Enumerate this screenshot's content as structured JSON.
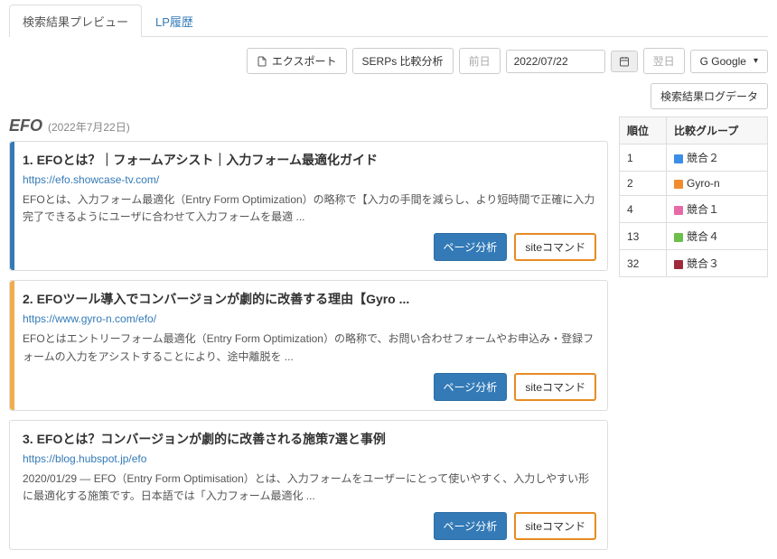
{
  "tabs": {
    "preview": "検索結果プレビュー",
    "lp_history": "LP履歴"
  },
  "toolbar": {
    "export": "エクスポート",
    "serps_compare": "SERPs 比較分析",
    "prev_day": "前日",
    "date_value": "2022/07/22",
    "next_day": "翌日",
    "engine": "G Google",
    "log_button": "検索結果ログデータ"
  },
  "heading": {
    "keyword": "EFO",
    "date": "(2022年7月22日)"
  },
  "results": [
    {
      "rank": "1.",
      "title": "EFOとは？｜フォームアシスト｜入力フォーム最適化ガイド",
      "url": "https://efo.showcase-tv.com/",
      "snippet": "EFOとは、入力フォーム最適化（Entry Form Optimization）の略称で【入力の手間を減らし、より短時間で正確に入力完了できるようにユーザに合わせて入力フォームを最適 ...",
      "stripe": "#337ab7",
      "page_analyze": "ページ分析",
      "site_cmd": "siteコマンド"
    },
    {
      "rank": "2.",
      "title": "EFOツール導入でコンバージョンが劇的に改善する理由【Gyro ...",
      "url": "https://www.gyro-n.com/efo/",
      "snippet": "EFOとはエントリーフォーム最適化（Entry Form Optimization）の略称で、お問い合わせフォームやお申込み・登録フォームの入力をアシストすることにより、途中離脱を ...",
      "stripe": "#f0ad4e",
      "page_analyze": "ページ分析",
      "site_cmd": "siteコマンド"
    },
    {
      "rank": "3.",
      "title": "EFOとは？コンバージョンが劇的に改善される施策7選と事例",
      "url": "https://blog.hubspot.jp/efo",
      "snippet": "2020/01/29 — EFO（Entry Form Optimisation）とは、入力フォームをユーザーにとって使いやすく、入力しやすい形に最適化する施策です。日本語では「入力フォーム最適化 ...",
      "stripe": "",
      "page_analyze": "ページ分析",
      "site_cmd": "siteコマンド"
    }
  ],
  "side": {
    "col_rank": "順位",
    "col_group": "比較グループ",
    "rows": [
      {
        "rank": "1",
        "color": "#3b8de8",
        "label": "競合２"
      },
      {
        "rank": "2",
        "color": "#f08c2e",
        "label": "Gyro-n"
      },
      {
        "rank": "4",
        "color": "#e66aa6",
        "label": "競合１"
      },
      {
        "rank": "13",
        "color": "#6bbf4a",
        "label": "競合４"
      },
      {
        "rank": "32",
        "color": "#9e2a3a",
        "label": "競合３"
      }
    ]
  }
}
